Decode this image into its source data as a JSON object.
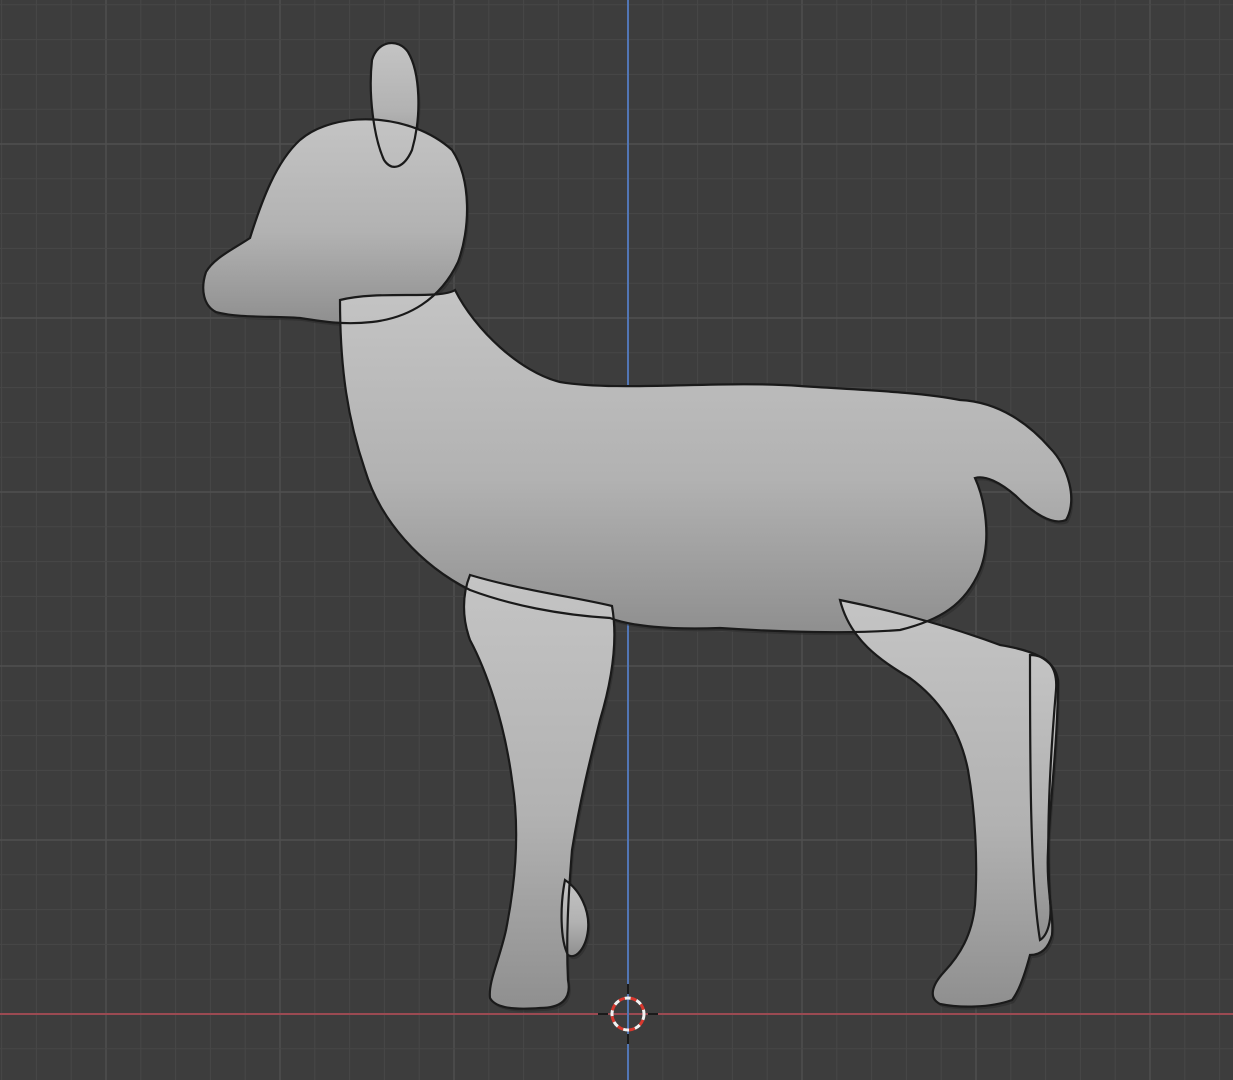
{
  "viewport": {
    "background_color": "#3d3d3d",
    "grid_minor_color": "#474747",
    "grid_major_color": "#505050",
    "x_axis_color": "#9b4a52",
    "z_axis_color": "#5276b5",
    "mesh_fill_color": "#b4b4b4",
    "mesh_shadow_color": "#6e6e6e",
    "wire_color": "#1e1e1e",
    "cursor_ring_color_a": "#d9392f",
    "cursor_ring_color_b": "#f2f2f2"
  },
  "object": {
    "type": "mesh",
    "subject": "fawn",
    "display": "solid-with-wireframe",
    "view": "side-orthographic"
  },
  "scene_elements": [
    {
      "name": "3d-cursor",
      "icon": "crosshair-ring-icon"
    },
    {
      "name": "world-origin-z-axis",
      "icon": "vertical-axis-line"
    },
    {
      "name": "world-origin-x-axis",
      "icon": "horizontal-axis-line"
    }
  ]
}
